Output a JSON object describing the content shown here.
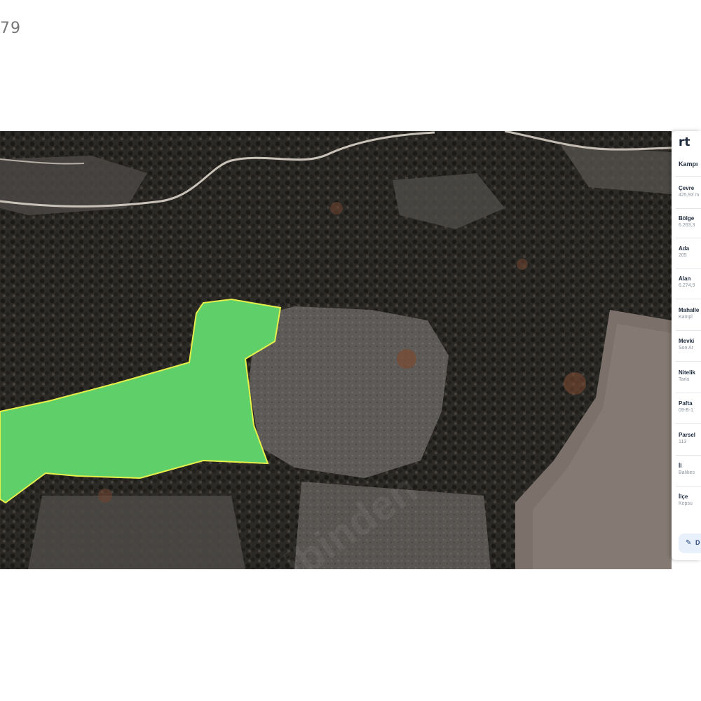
{
  "page": {
    "id_fragment": "79"
  },
  "map": {
    "parcel_fill": "#5fcf6a",
    "parcel_stroke": "#e6f04a",
    "watermark": "sahibinden"
  },
  "panel": {
    "logo": "rt",
    "title": "Kampı",
    "rows": [
      {
        "label": "Çevre",
        "value": "425,93 m"
      },
      {
        "label": "Bölge",
        "value": "6.263,3"
      },
      {
        "label": "Ada",
        "value": "205"
      },
      {
        "label": "Alan",
        "value": "6.274,9"
      },
      {
        "label": "Mahalle",
        "value": "Kampl"
      },
      {
        "label": "Mevki",
        "value": "Son Ar"
      },
      {
        "label": "Nitelik",
        "value": "Tarla"
      },
      {
        "label": "Pafta",
        "value": "09-B-1"
      },
      {
        "label": "Parsel",
        "value": "113"
      },
      {
        "label": "İl",
        "value": "Balıkes"
      },
      {
        "label": "İlçe",
        "value": "Kepsu"
      }
    ],
    "button": {
      "icon": "pencil-icon",
      "label": "D"
    }
  }
}
